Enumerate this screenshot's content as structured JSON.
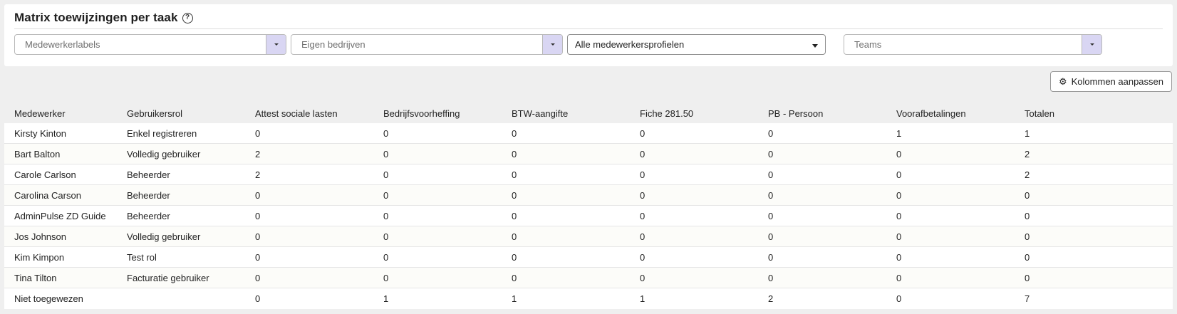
{
  "header": {
    "title": "Matrix toewijzingen per taak",
    "help_icon": "question-circle-icon"
  },
  "filters": {
    "employee_labels": {
      "placeholder": "Medewerkerlabels"
    },
    "own_companies": {
      "placeholder": "Eigen bedrijven"
    },
    "employee_profiles": {
      "value": "Alle medewerkersprofielen"
    },
    "teams": {
      "placeholder": "Teams"
    }
  },
  "toolbar": {
    "customize_columns_label": "Kolommen aanpassen",
    "customize_columns_icon": "gear-icon"
  },
  "colors": {
    "accent_button_bg": "#d9d6f3",
    "page_bg": "#efefef",
    "card_bg": "#ffffff"
  },
  "table": {
    "columns": [
      "Medewerker",
      "Gebruikersrol",
      "Attest sociale lasten",
      "Bedrijfsvoorheffing",
      "BTW-aangifte",
      "Fiche 281.50",
      "PB - Persoon",
      "Voorafbetalingen",
      "Totalen"
    ],
    "rows": [
      [
        "Kirsty Kinton",
        "Enkel registreren",
        "0",
        "0",
        "0",
        "0",
        "0",
        "1",
        "1"
      ],
      [
        "Bart Balton",
        "Volledig gebruiker",
        "2",
        "0",
        "0",
        "0",
        "0",
        "0",
        "2"
      ],
      [
        "Carole Carlson",
        "Beheerder",
        "2",
        "0",
        "0",
        "0",
        "0",
        "0",
        "2"
      ],
      [
        "Carolina Carson",
        "Beheerder",
        "0",
        "0",
        "0",
        "0",
        "0",
        "0",
        "0"
      ],
      [
        "AdminPulse ZD Guide",
        "Beheerder",
        "0",
        "0",
        "0",
        "0",
        "0",
        "0",
        "0"
      ],
      [
        "Jos Johnson",
        "Volledig gebruiker",
        "0",
        "0",
        "0",
        "0",
        "0",
        "0",
        "0"
      ],
      [
        "Kim Kimpon",
        "Test rol",
        "0",
        "0",
        "0",
        "0",
        "0",
        "0",
        "0"
      ],
      [
        "Tina Tilton",
        "Facturatie gebruiker",
        "0",
        "0",
        "0",
        "0",
        "0",
        "0",
        "0"
      ],
      [
        "Niet toegewezen",
        "",
        "0",
        "1",
        "1",
        "1",
        "2",
        "0",
        "7"
      ]
    ]
  }
}
